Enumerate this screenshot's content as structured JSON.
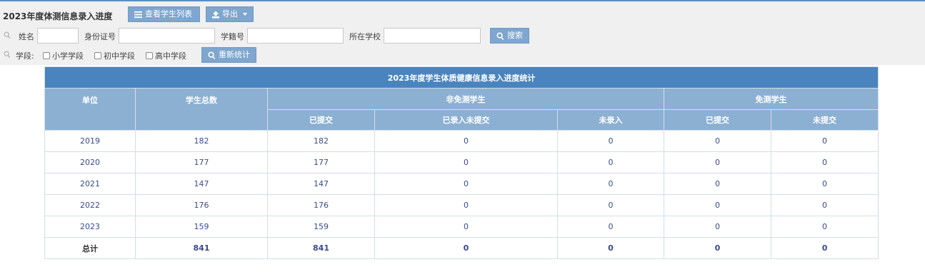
{
  "page": {
    "title": "2023年度体测信息录入进度"
  },
  "toolbar": {
    "list_button": "查看学生列表",
    "export_button": "导出"
  },
  "search": {
    "name_label": "姓名",
    "id_label": "身份证号",
    "student_no_label": "学籍号",
    "school_label": "所在学校",
    "search_button": "搜索",
    "name_value": "",
    "id_value": "",
    "student_no_value": "",
    "school_value": ""
  },
  "stage": {
    "label": "学段:",
    "options": [
      "小学学段",
      "初中学段",
      "高中学段"
    ],
    "recount_button": "重新统计"
  },
  "table": {
    "caption": "2023年度学生体质健康信息录入进度统计",
    "col_unit": "单位",
    "col_total": "学生总数",
    "group_non_exempt": "非免测学生",
    "group_exempt": "免测学生",
    "sub_submitted": "已提交",
    "sub_entered_not_submitted": "已录入未提交",
    "sub_not_entered": "未录入",
    "sub_exempt_submitted": "已提交",
    "sub_exempt_not_submitted": "未提交",
    "rows": [
      [
        "2019",
        "182",
        "182",
        "0",
        "0",
        "0",
        "0"
      ],
      [
        "2020",
        "177",
        "177",
        "0",
        "0",
        "0",
        "0"
      ],
      [
        "2021",
        "147",
        "147",
        "0",
        "0",
        "0",
        "0"
      ],
      [
        "2022",
        "176",
        "176",
        "0",
        "0",
        "0",
        "0"
      ],
      [
        "2023",
        "159",
        "159",
        "0",
        "0",
        "0",
        "0"
      ]
    ],
    "total": [
      "总计",
      "841",
      "841",
      "0",
      "0",
      "0",
      "0"
    ]
  }
}
